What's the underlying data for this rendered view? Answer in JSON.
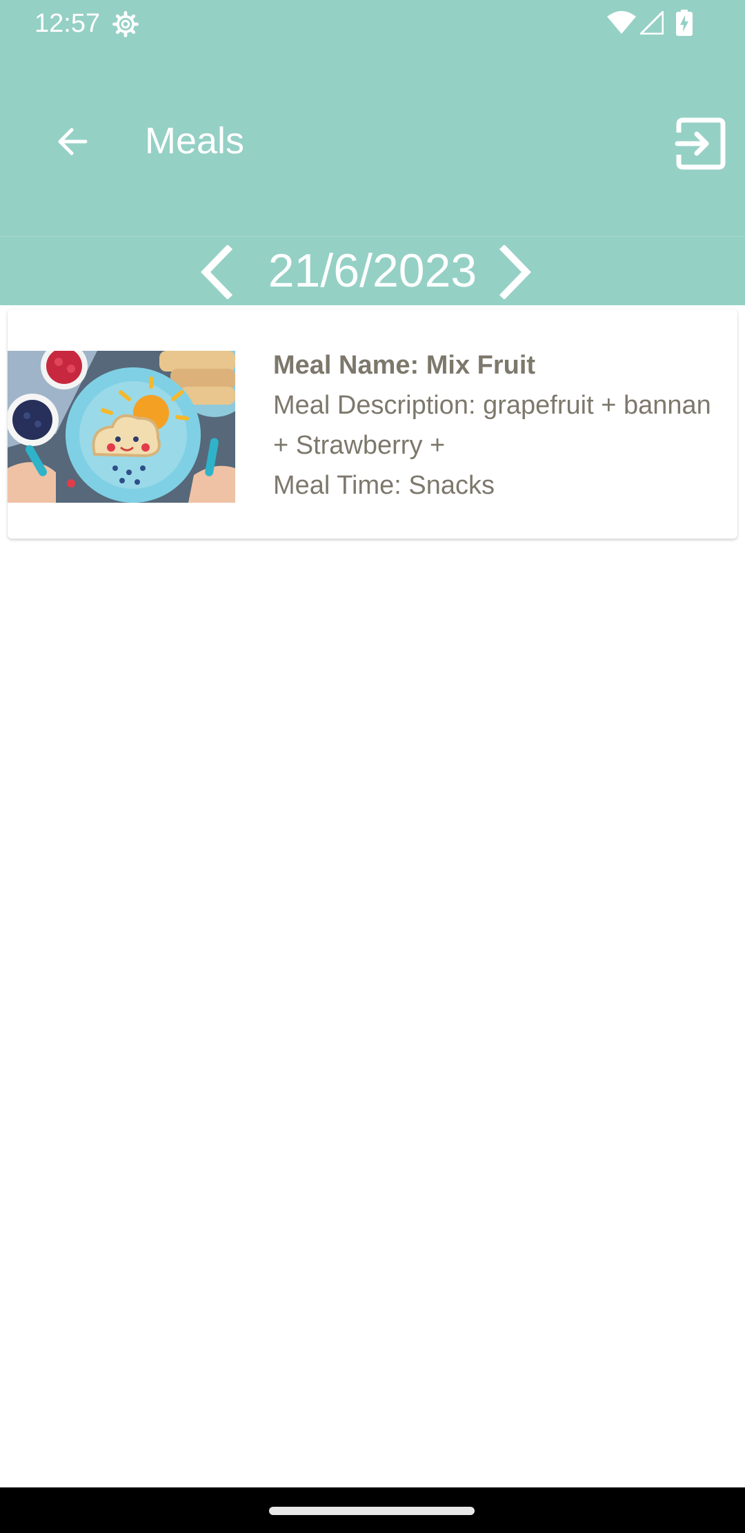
{
  "status_bar": {
    "time": "12:57"
  },
  "toolbar": {
    "title": "Meals"
  },
  "date_nav": {
    "date": "21/6/2023"
  },
  "meals": [
    {
      "name_line": "Meal Name: Mix Fruit",
      "description_line": "Meal Description: grapefruit + bannan + Strawberry  +",
      "time_line": "Meal Time: Snacks"
    }
  ],
  "colors": {
    "header": "#95d0c5",
    "text": "#7d786c"
  }
}
